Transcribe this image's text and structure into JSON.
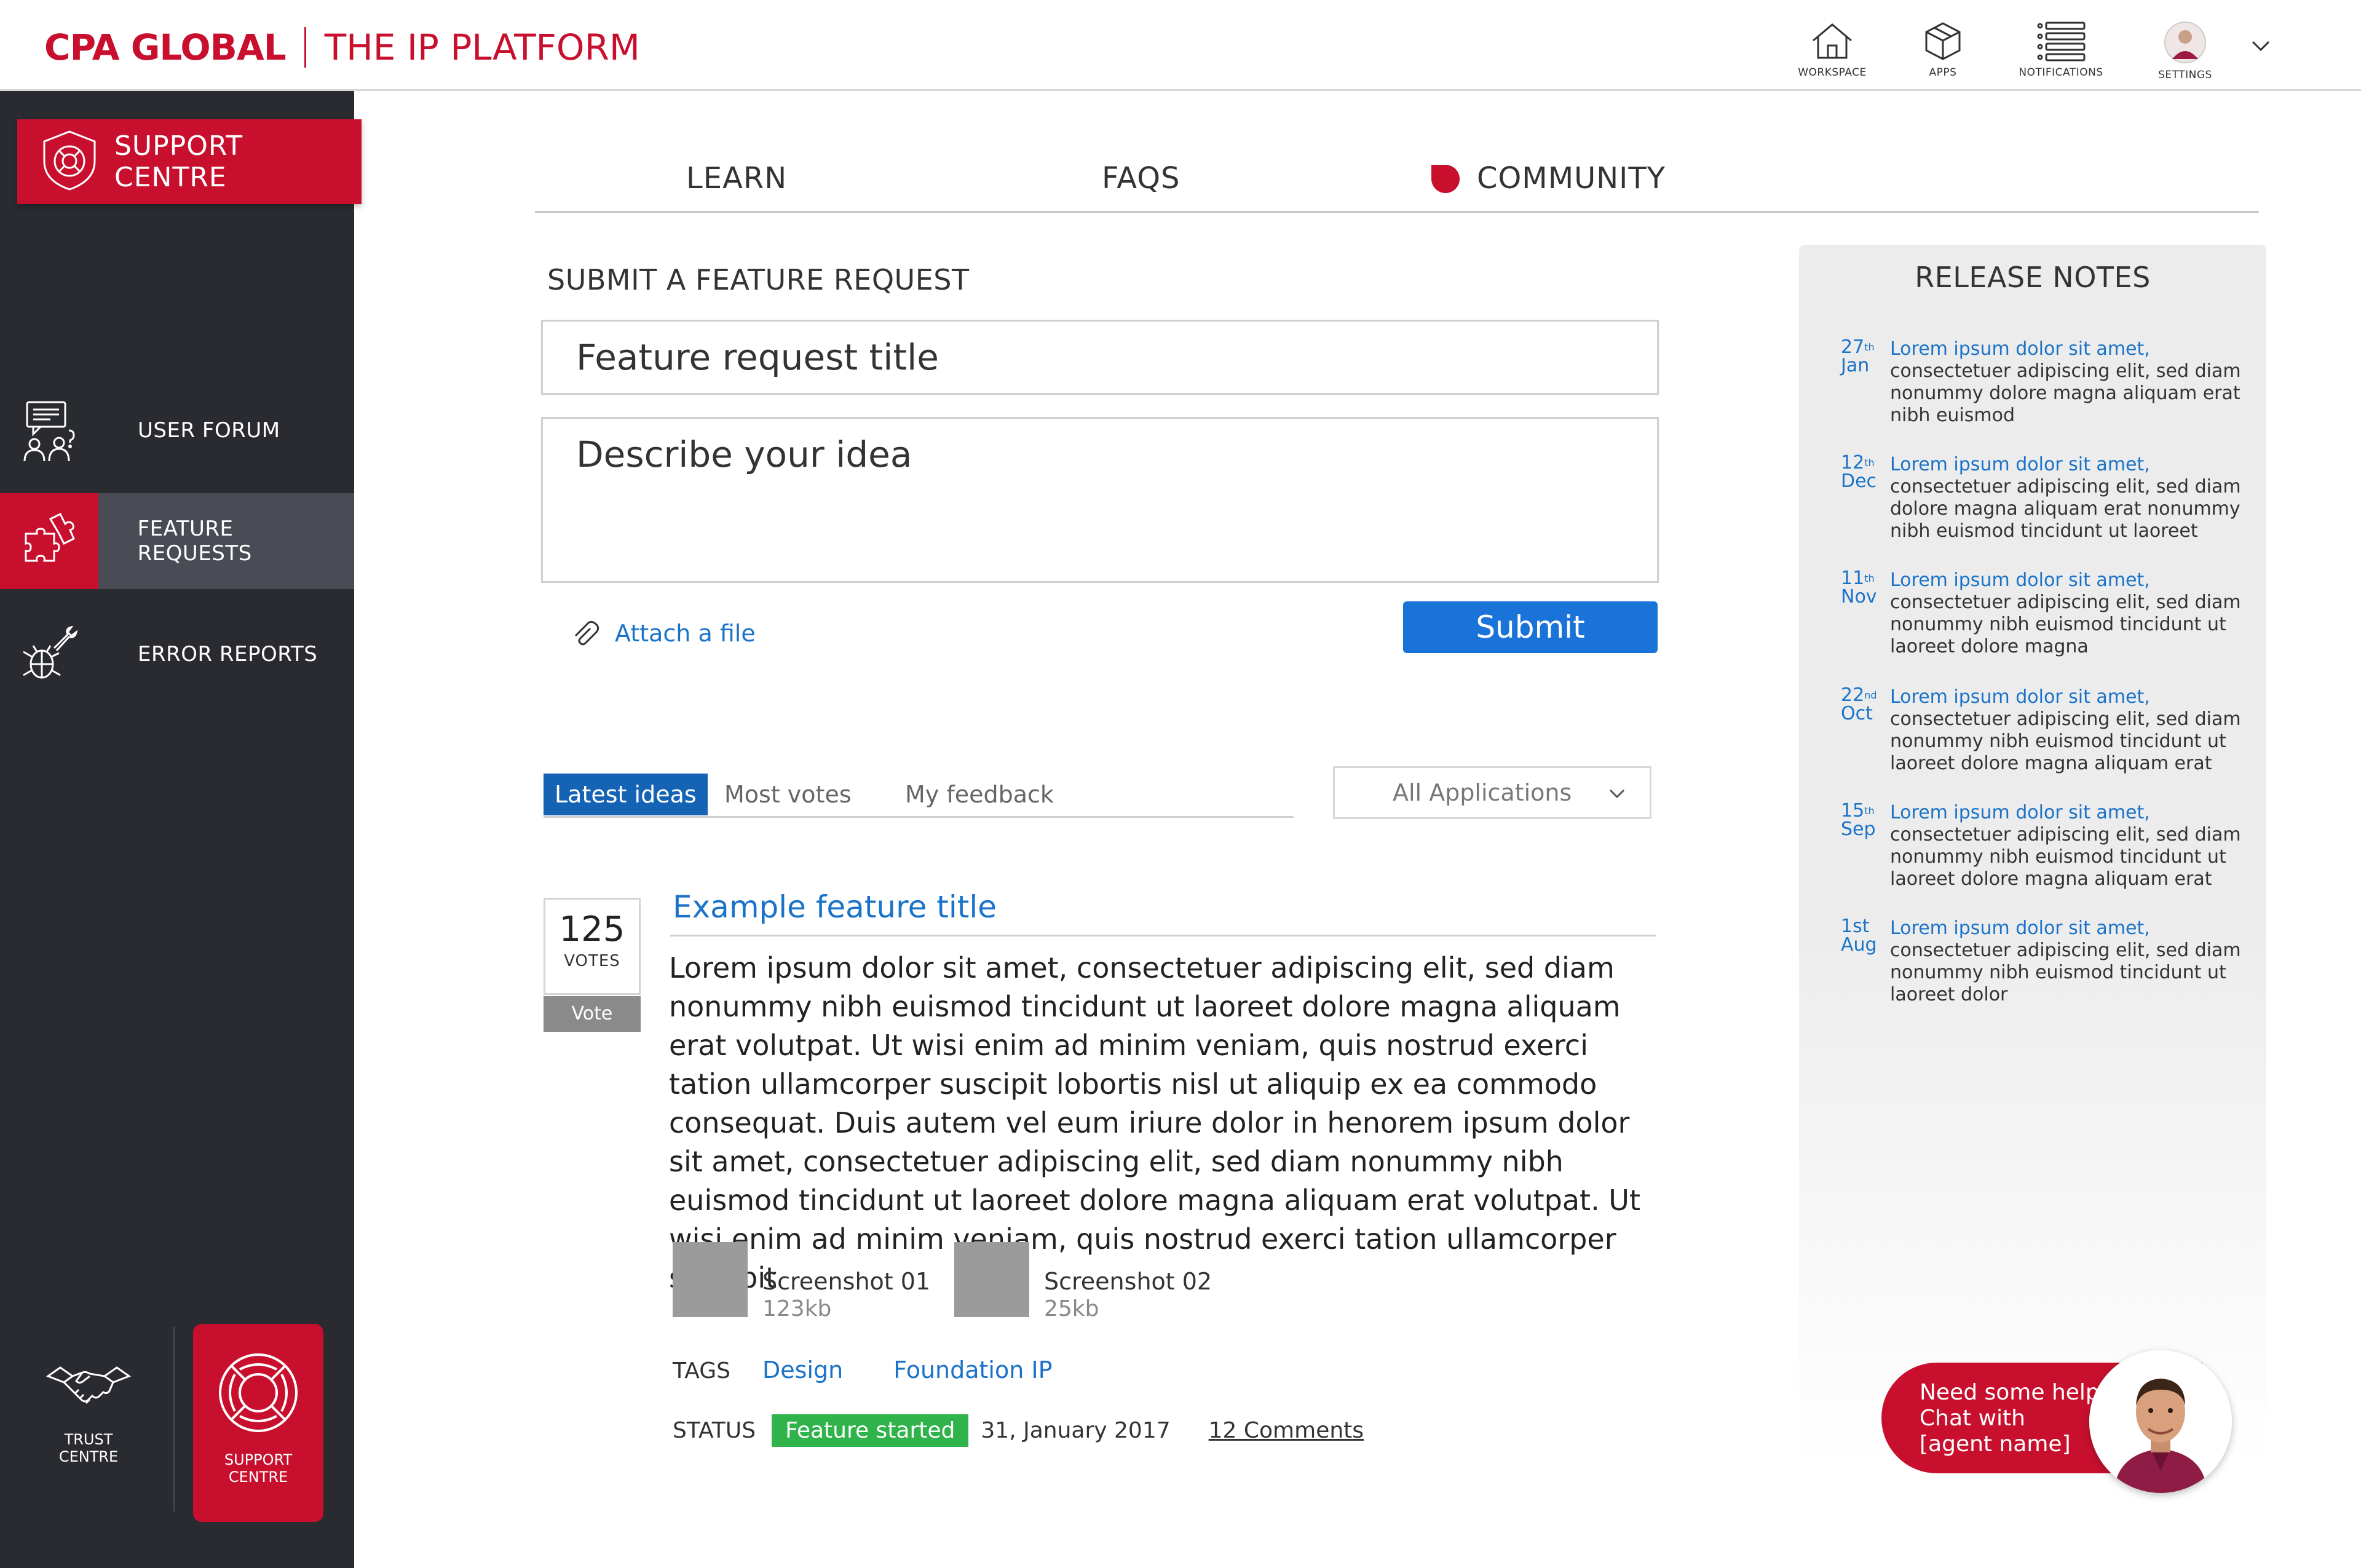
{
  "header": {
    "brand": "CPA GLOBAL",
    "product": "THE IP PLATFORM",
    "nav": [
      {
        "label": "WORKSPACE",
        "icon": "house-icon"
      },
      {
        "label": "APPS",
        "icon": "cube-icon"
      },
      {
        "label": "NOTIFICATIONS",
        "icon": "list-icon"
      },
      {
        "label": "SETTINGS",
        "icon": "user-avatar-icon"
      }
    ]
  },
  "sidebar": {
    "banner_label": "SUPPORT CENTRE",
    "items": [
      {
        "label": "USER FORUM",
        "icon": "chat-people-icon"
      },
      {
        "label": "FEATURE REQUESTS",
        "icon": "puzzle-icon"
      },
      {
        "label": "ERROR REPORTS",
        "icon": "bug-wrench-icon"
      }
    ],
    "trust_centre_label_1": "TRUST",
    "trust_centre_label_2": "CENTRE",
    "support_centre_label_1": "SUPPORT",
    "support_centre_label_2": "CENTRE"
  },
  "main_tabs": {
    "learn": "LEARN",
    "faqs": "FAQS",
    "community": "COMMUNITY"
  },
  "form": {
    "title": "SUBMIT A FEATURE REQUEST",
    "title_placeholder": "Feature request title",
    "description_placeholder": "Describe your idea",
    "attach_label": "Attach a file",
    "submit_label": "Submit"
  },
  "idea_tabs": {
    "latest": "Latest ideas",
    "most_votes": "Most votes",
    "my_feedback": "My feedback",
    "filter_value": "All Applications"
  },
  "feature": {
    "votes": "125",
    "votes_label": "VOTES",
    "vote_button": "Vote",
    "title": "Example feature title",
    "body": "Lorem ipsum dolor sit amet, consectetuer adipiscing elit, sed diam nonummy nibh euismod tincidunt ut laoreet dolore magna aliquam erat volutpat. Ut wisi enim ad minim veniam, quis nostrud exerci tation ullamcorper suscipit lobortis nisl ut aliquip ex ea commodo consequat. Duis autem vel eum iriure dolor in henorem ipsum dolor sit amet, consectetuer adipiscing elit, sed diam nonummy nibh euismod tincidunt ut laoreet dolore magna aliquam erat volutpat. Ut wisi enim ad minim veniam, quis nostrud exerci tation ullamcorper suscipit",
    "screenshots": [
      {
        "name": "Screenshot 01",
        "size": "123kb"
      },
      {
        "name": "Screenshot 02",
        "size": "25kb"
      }
    ],
    "tags_label": "TAGS",
    "tags": [
      "Design",
      "Foundation IP"
    ],
    "status_label": "STATUS",
    "status": "Feature started",
    "date": "31, January 2017",
    "comments": "12 Comments",
    "status_color": "#2fb34a"
  },
  "release_notes": {
    "title": "RELEASE NOTES",
    "items": [
      {
        "day": "27",
        "suffix": "th",
        "month": "Jan",
        "lead": "Lorem ipsum dolor sit amet,",
        "text": "consectetuer adipiscing elit, sed diam nonummy dolore magna aliquam erat nibh euismod"
      },
      {
        "day": "12",
        "suffix": "th",
        "month": "Dec",
        "lead": "Lorem ipsum dolor sit amet,",
        "text": "consectetuer adipiscing elit, sed diam dolore magna aliquam erat  nonummy nibh euismod tincidunt ut laoreet"
      },
      {
        "day": "11",
        "suffix": "th",
        "month": "Nov",
        "lead": "Lorem ipsum dolor sit amet,",
        "text": "consectetuer adipiscing elit, sed diam nonummy nibh euismod tincidunt ut laoreet dolore magna"
      },
      {
        "day": "22",
        "suffix": "nd",
        "month": "Oct",
        "lead": "Lorem ipsum dolor sit amet,",
        "text": "consectetuer adipiscing elit, sed diam nonummy nibh euismod tincidunt ut laoreet dolore magna aliquam erat"
      },
      {
        "day": "15",
        "suffix": "th",
        "month": "Sep",
        "lead": "Lorem ipsum dolor sit amet,",
        "text": "consectetuer adipiscing elit, sed diam nonummy nibh euismod tincidunt ut laoreet dolore magna aliquam erat"
      },
      {
        "day": "1st",
        "suffix": "",
        "month": "Aug",
        "lead": "Lorem ipsum dolor sit amet,",
        "text": "consectetuer adipiscing elit, sed diam nonummy nibh euismod tincidunt ut laoreet dolor"
      }
    ]
  },
  "chat": {
    "line1": "Need some help",
    "line2": "Chat with",
    "line3": "[agent name]"
  },
  "colors": {
    "brand_red": "#c8102e",
    "sidebar_bg": "#2a2b30",
    "link_blue": "#1a73c9",
    "submit_blue": "#1a73d8"
  }
}
